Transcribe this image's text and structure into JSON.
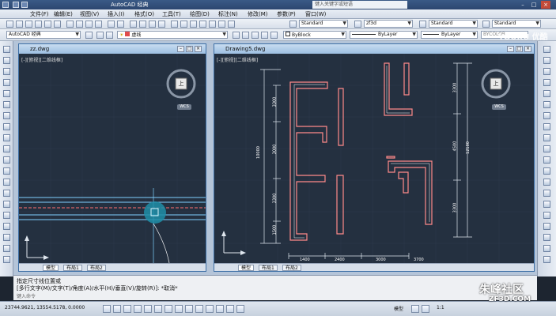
{
  "app": {
    "title": "AutoCAD 经典",
    "search_placeholder": "键入关键字或短语"
  },
  "menu": [
    "文件(F)",
    "编辑(E)",
    "视图(V)",
    "插入(I)",
    "格式(O)",
    "工具(T)",
    "绘图(D)",
    "标注(N)",
    "修改(M)",
    "参数(P)",
    "窗口(W)"
  ],
  "toolbar": {
    "workspace": "AutoCAD 经典",
    "layer": "虚线",
    "textstyle": "Standard",
    "dimstyle": "zf3d",
    "tablestyle": "Standard",
    "multileaderstyle": "Standard",
    "color": "ByBlock",
    "linetype": "ByLayer",
    "lineweight": "ByLayer",
    "plotstyle": "BYCOLOR"
  },
  "documents": {
    "left": {
      "title": "zz.dwg",
      "view_label": "[-][俯视][二维线框]",
      "cube_label": "上",
      "wcs": "WCS",
      "tabs": [
        "模型",
        "布局1",
        "布局2"
      ]
    },
    "right": {
      "title": "Drawing5.dwg",
      "view_label": "[-][俯视][二维线框]",
      "cube_label": "上",
      "wcs": "WCS",
      "tabs": [
        "模型",
        "布局1",
        "布局2"
      ],
      "dim_labels": {
        "left_overall": "10000",
        "left_top": "3300",
        "left_mid": "3000",
        "left_low": "3300",
        "left_bottom": "1500",
        "right_overall": "12100",
        "right_top": "3300",
        "right_mid": "4500",
        "right_low": "3300",
        "bottom_a": "1400",
        "bottom_b": "2400",
        "bottom_c": "3000",
        "bottom_d": "3700"
      }
    }
  },
  "command": {
    "line1": "指定尺寸线位置或",
    "line2": "[多行文字(M)/文字(T)/角度(A)/水平(H)/垂直(V)/旋转(R)]: *取消*",
    "prompt": "键入命令"
  },
  "status": {
    "coords": "23744.9621, 13554.5178, 0.0000",
    "model": "模型",
    "scale": "1:1"
  },
  "watermarks": {
    "youku": "YOUKU 优酷",
    "site_cn": "朱峰社区",
    "site_en": "ZF3D.COM"
  }
}
